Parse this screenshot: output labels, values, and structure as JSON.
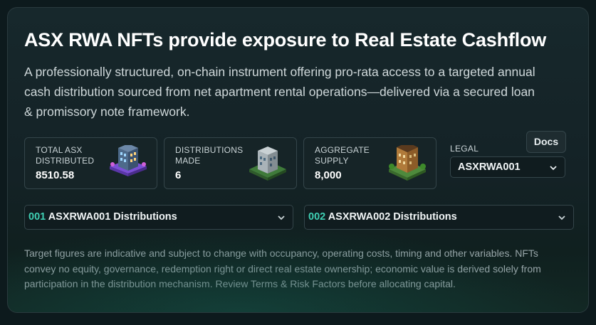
{
  "header": {
    "title": "ASX RWA NFTs provide exposure to Real Estate Cashflow",
    "subtitle": "A professionally structured, on-chain instrument offering pro-rata access to a targeted annual cash distribution sourced from net apartment rental operations—delivered via a secured loan & promissory note framework."
  },
  "stats": [
    {
      "label": "TOTAL ASX DISTRIBUTED",
      "value": "8510.58",
      "icon": "purple-building-icon"
    },
    {
      "label": "DISTRIBUTIONS MADE",
      "value": "6",
      "icon": "grey-building-icon"
    },
    {
      "label": "AGGREGATE SUPPLY",
      "value": "8,000",
      "icon": "brick-building-icon"
    }
  ],
  "legal": {
    "label": "LEGAL",
    "docs_label": "Docs",
    "selected": "ASXRWA001"
  },
  "distributions": [
    {
      "num": "001",
      "label": "ASXRWA001 Distributions"
    },
    {
      "num": "002",
      "label": "ASXRWA002 Distributions"
    }
  ],
  "disclaimer": "Target figures are indicative and subject to change with occupancy, operating costs, timing and other variables. NFTs convey no equity, governance, redemption right or direct real estate ownership; economic value is derived solely from participation in the distribution mechanism. Review Terms & Risk Factors before allocating capital.",
  "colors": {
    "accent": "#3fd0b4",
    "background": "#0d1a1d",
    "panel": "#17282c"
  }
}
